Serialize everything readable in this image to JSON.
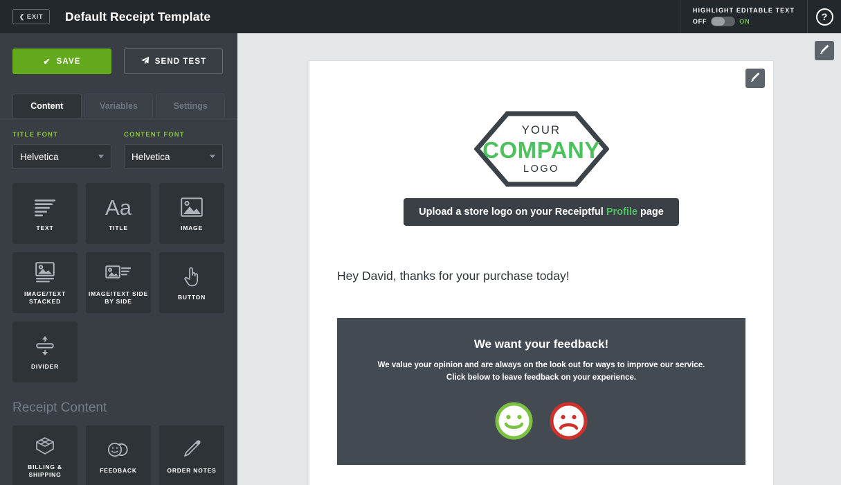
{
  "topbar": {
    "exit_label": "EXIT",
    "exit_icon": "chevron-left-icon",
    "title": "Default Receipt Template",
    "highlight_label": "HIGHLIGHT EDITABLE TEXT",
    "toggle_off_label": "OFF",
    "toggle_on_label": "ON",
    "toggle_state": "off",
    "help_label": "?"
  },
  "sidebar": {
    "save_label": "SAVE",
    "save_icon": "check-icon",
    "send_test_label": "SEND TEST",
    "send_test_icon": "paper-plane-icon",
    "tabs": [
      {
        "label": "Content",
        "active": true
      },
      {
        "label": "Variables",
        "active": false
      },
      {
        "label": "Settings",
        "active": false
      }
    ],
    "title_font": {
      "label": "TITLE FONT",
      "value": "Helvetica"
    },
    "content_font": {
      "label": "CONTENT FONT",
      "value": "Helvetica"
    },
    "blocks": [
      {
        "label": "TEXT",
        "icon": "text-lines-icon"
      },
      {
        "label": "TITLE",
        "icon": "aa-icon",
        "glyph": "Aa"
      },
      {
        "label": "IMAGE",
        "icon": "image-icon"
      },
      {
        "label": "IMAGE/TEXT STACKED",
        "icon": "image-text-stacked-icon"
      },
      {
        "label": "IMAGE/TEXT SIDE BY SIDE",
        "icon": "image-text-side-icon"
      },
      {
        "label": "BUTTON",
        "icon": "pointing-hand-icon"
      },
      {
        "label": "DIVIDER",
        "icon": "divider-arrows-icon"
      }
    ],
    "receipt_section_title": "Receipt Content",
    "receipt_blocks": [
      {
        "label": "BILLING & SHIPPING",
        "icon": "open-box-icon"
      },
      {
        "label": "FEEDBACK",
        "icon": "two-smileys-icon"
      },
      {
        "label": "ORDER NOTES",
        "icon": "pencil-icon"
      }
    ]
  },
  "canvas": {
    "side_edit_icon": "pencil-edit-icon",
    "email_edit_icon": "pencil-edit-icon",
    "logo": {
      "line1": "YOUR",
      "line2": "COMPANY",
      "line3": "LOGO"
    },
    "tooltip": {
      "prefix": "Upload a store logo on your Receiptful ",
      "link": "Profile",
      "suffix": " page"
    },
    "greeting": "Hey David, thanks for your purchase today!",
    "feedback": {
      "title": "We want your feedback!",
      "line1": "We value your opinion and are always on the look out for ways to improve our service.",
      "line2": "Click below to leave feedback on your experience.",
      "happy_icon": "happy-face-icon",
      "sad_icon": "sad-face-icon"
    }
  },
  "colors": {
    "accent_green": "#62a91e",
    "label_green": "#8dc63f",
    "logo_green": "#4cc15e",
    "happy_green": "#7cc143",
    "sad_red": "#d0312a",
    "topbar_dark": "#23282d",
    "sidebar_dark": "#383e44",
    "tile_dark": "#2e3338",
    "feedback_dark": "#434a52"
  }
}
